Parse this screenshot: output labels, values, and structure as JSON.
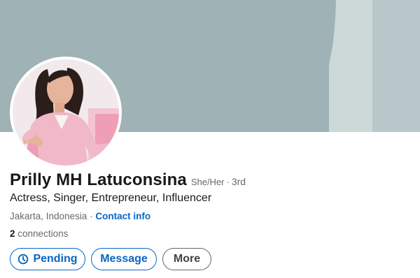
{
  "profile": {
    "name": "Prilly MH Latuconsina",
    "pronouns": "She/Her",
    "separator": "·",
    "degree": "3rd",
    "headline": "Actress, Singer, Entrepreneur, Influencer",
    "location": "Jakarta, Indonesia",
    "location_separator": "·",
    "contact_info_label": "Contact info",
    "connections_count": "2",
    "connections_label": "connections"
  },
  "actions": {
    "pending_label": "Pending",
    "pending_icon": "clock-icon",
    "message_label": "Message",
    "more_label": "More"
  },
  "colors": {
    "link_blue": "#0a66c2",
    "banner_main": "#9fb2b5",
    "banner_light_stripe": "#cdd8d9",
    "banner_mid_stripe": "#b8c8ca",
    "avatar_outfit_pink": "#f1b8c8"
  }
}
